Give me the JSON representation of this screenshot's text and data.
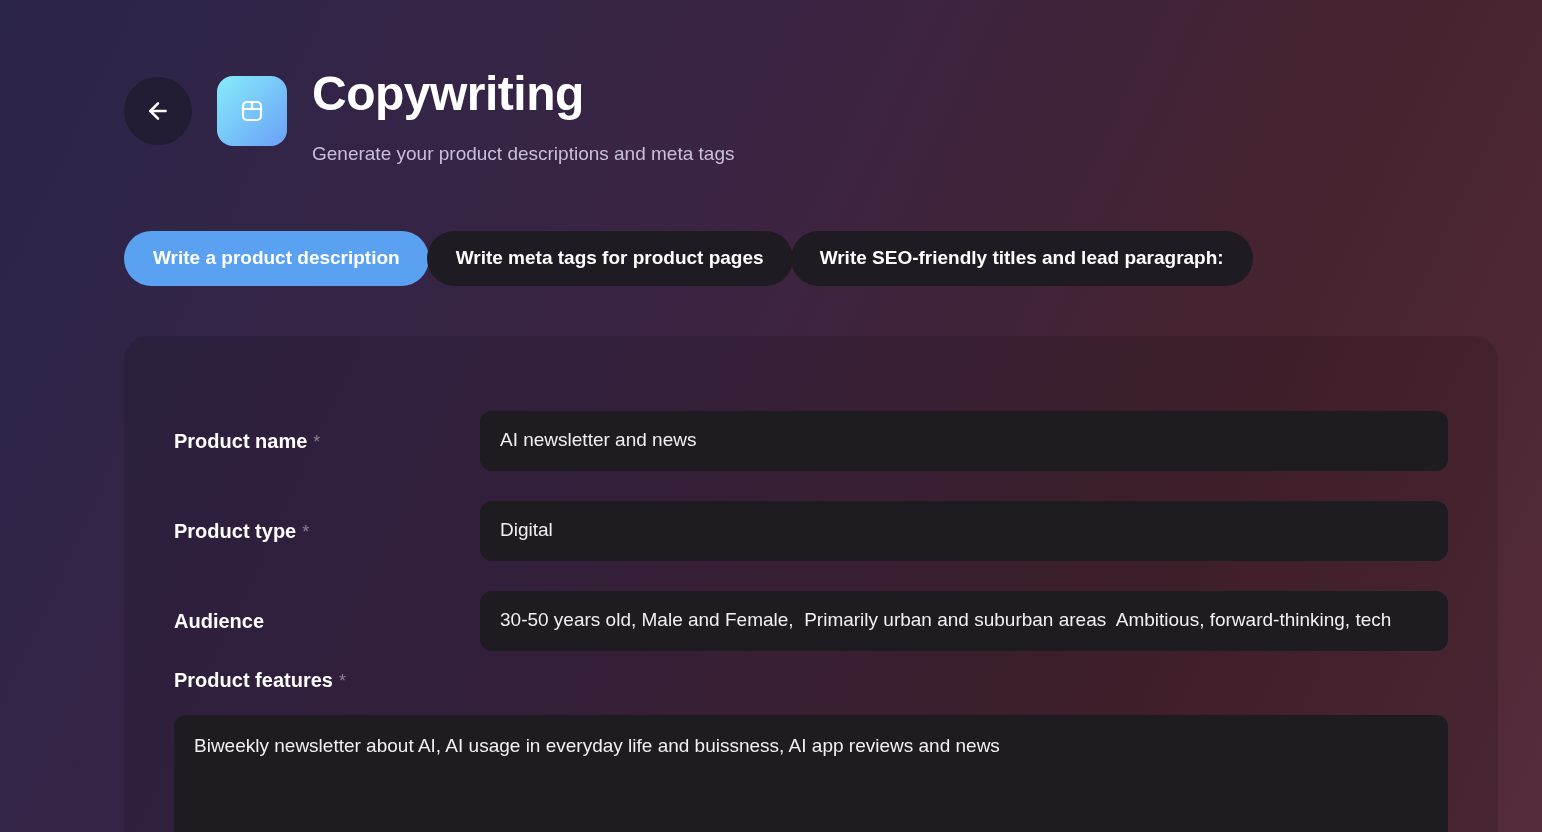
{
  "header": {
    "title": "Copywriting",
    "subtitle": "Generate your product descriptions and meta tags"
  },
  "tabs": [
    {
      "label": "Write a product description",
      "selected": true
    },
    {
      "label": "Write meta tags for product pages",
      "selected": false
    },
    {
      "label": "Write SEO-friendly titles and lead paragraph:",
      "selected": false
    }
  ],
  "form": {
    "fields": [
      {
        "kind": "input",
        "label": "Product name",
        "required_mark": "*",
        "value": "AI newsletter and news"
      },
      {
        "kind": "input",
        "label": "Product type",
        "required_mark": "*",
        "value": "Digital"
      },
      {
        "kind": "input",
        "label": "Audience",
        "value": "30-50 years old, Male and Female,  Primarily urban and suburban areas  Ambitious, forward-thinking, tech"
      },
      {
        "kind": "textarea",
        "label": "Product features",
        "required_mark": "*",
        "value": "Biweekly newsletter about AI, AI usage in everyday life and buissness, AI app reviews and news"
      }
    ]
  }
}
